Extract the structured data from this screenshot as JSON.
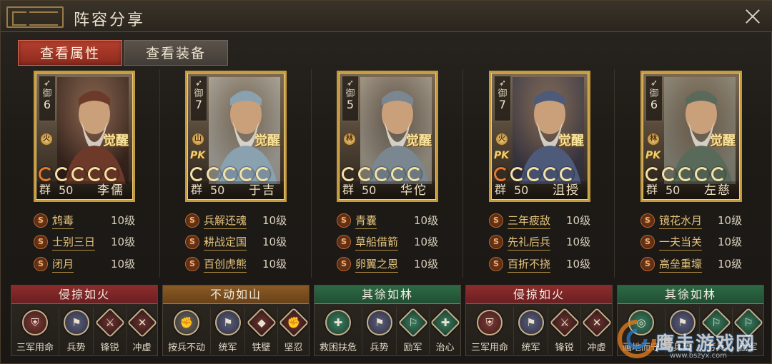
{
  "title": "阵容分享",
  "tabs": {
    "attributes": "查看属性",
    "equipment": "查看装备"
  },
  "heroes": [
    {
      "name": "李儒",
      "faction": "群",
      "level": "50",
      "def_label": "御",
      "def_value": "6",
      "type_badge": "火",
      "pk": "",
      "awake": "觉醒",
      "stars": 5,
      "red_stars": 1,
      "skills": [
        {
          "icon": "S",
          "name": "鸩毒",
          "level": "10级"
        },
        {
          "icon": "S",
          "name": "士别三日",
          "level": "10级"
        },
        {
          "icon": "S",
          "name": "闭月",
          "level": "10级"
        }
      ]
    },
    {
      "name": "于吉",
      "faction": "群",
      "level": "50",
      "def_label": "御",
      "def_value": "7",
      "type_badge": "山",
      "pk": "PK",
      "awake": "觉醒",
      "stars": 5,
      "red_stars": 0,
      "skills": [
        {
          "icon": "S",
          "name": "兵解还魂",
          "level": "10级"
        },
        {
          "icon": "S",
          "name": "耕战定国",
          "level": "10级"
        },
        {
          "icon": "S",
          "name": "百创虎熊",
          "level": "10级"
        }
      ]
    },
    {
      "name": "华佗",
      "faction": "群",
      "level": "50",
      "def_label": "御",
      "def_value": "5",
      "type_badge": "林",
      "pk": "",
      "awake": "觉醒",
      "stars": 5,
      "red_stars": 0,
      "skills": [
        {
          "icon": "S",
          "name": "青囊",
          "level": "10级"
        },
        {
          "icon": "S",
          "name": "草船借箭",
          "level": "10级"
        },
        {
          "icon": "S",
          "name": "卵翼之恩",
          "level": "10级"
        }
      ]
    },
    {
      "name": "沮授",
      "faction": "群",
      "level": "50",
      "def_label": "御",
      "def_value": "7",
      "type_badge": "火",
      "pk": "PK",
      "awake": "觉醒",
      "stars": 5,
      "red_stars": 1,
      "skills": [
        {
          "icon": "S",
          "name": "三年疲敌",
          "level": "10级"
        },
        {
          "icon": "S",
          "name": "先礼后兵",
          "level": "10级"
        },
        {
          "icon": "S",
          "name": "百折不挠",
          "level": "10级"
        }
      ]
    },
    {
      "name": "左慈",
      "faction": "群",
      "level": "50",
      "def_label": "御",
      "def_value": "6",
      "type_badge": "林",
      "pk": "PK",
      "awake": "觉醒",
      "stars": 5,
      "red_stars": 0,
      "skills": [
        {
          "icon": "S",
          "name": "镜花水月",
          "level": "10级"
        },
        {
          "icon": "S",
          "name": "一夫当关",
          "level": "10级"
        },
        {
          "icon": "S",
          "name": "高垒重壕",
          "level": "10级"
        }
      ]
    }
  ],
  "tactics": [
    {
      "header": "侵掠如火",
      "color": "red",
      "items": [
        {
          "name": "三军用命",
          "icon": "shield-icon"
        },
        {
          "name": "兵势",
          "icon": "banner-icon"
        },
        {
          "name": "锋锐",
          "icon": "blade-icon"
        },
        {
          "name": "冲虚",
          "icon": "sword-icon"
        }
      ]
    },
    {
      "header": "不动如山",
      "color": "brown",
      "items": [
        {
          "name": "按兵不动",
          "icon": "fist-icon"
        },
        {
          "name": "统军",
          "icon": "banner-icon"
        },
        {
          "name": "铁壁",
          "icon": "helmet-icon"
        },
        {
          "name": "坚忍",
          "icon": "fist-icon"
        }
      ]
    },
    {
      "header": "其徐如林",
      "color": "green",
      "items": [
        {
          "name": "救困扶危",
          "icon": "heal-icon"
        },
        {
          "name": "兵势",
          "icon": "banner-icon"
        },
        {
          "name": "励军",
          "icon": "flag-icon"
        },
        {
          "name": "治心",
          "icon": "heal-icon"
        }
      ]
    },
    {
      "header": "侵掠如火",
      "color": "red",
      "items": [
        {
          "name": "三军用命",
          "icon": "shield-icon"
        },
        {
          "name": "统军",
          "icon": "banner-icon"
        },
        {
          "name": "锋锐",
          "icon": "blade-icon"
        },
        {
          "name": "冲虚",
          "icon": "sword-icon"
        }
      ]
    },
    {
      "header": "其徐如林",
      "color": "green",
      "items": [
        {
          "name": "画地而守",
          "icon": "ring-icon"
        },
        {
          "name": "兵势",
          "icon": "banner-icon"
        },
        {
          "name": "厉兵",
          "icon": "flag-icon"
        },
        {
          "name": "励军",
          "icon": "flag-icon"
        }
      ]
    }
  ],
  "watermark": {
    "text": "鹰击游戏网",
    "url": "www.bszyx.com"
  }
}
